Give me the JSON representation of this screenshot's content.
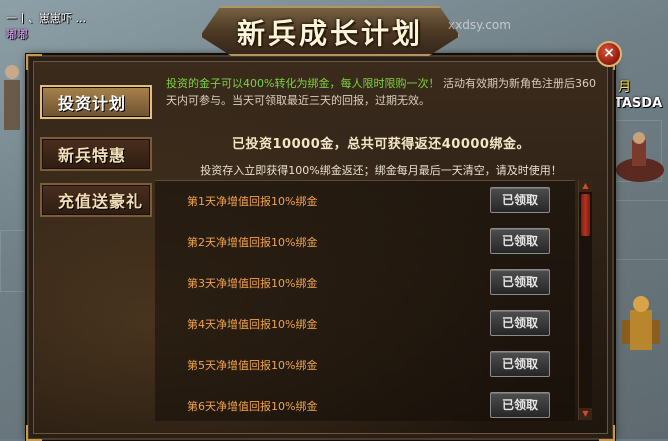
{
  "scene": {
    "top_left_line": "一丨、崽崽吓 ...",
    "top_left_name": "嘟嘟",
    "top_right_char": "月",
    "right_name": "TASDA"
  },
  "window": {
    "title": "新兵成长计划",
    "watermark": "xxdsy.com",
    "close_label": "×"
  },
  "tabs": [
    {
      "label": "投资计划",
      "active": true
    },
    {
      "label": "新兵特惠",
      "active": false
    },
    {
      "label": "充值送豪礼",
      "active": false
    }
  ],
  "content": {
    "desc_highlight": "投资的金子可以400%转化为绑金，每人限时限购一次！",
    "desc_rest": "活动有效期为新角色注册后360天内可参与。当天可领取最近三天的回报，过期无效。",
    "summary": "已投资10000金，总共可获得返还40000绑金。",
    "note": "投资存入立即获得100%绑金返还；绑金每月最后一天清空，请及时使用！"
  },
  "rows": [
    {
      "label": "第1天净增值回报10%绑金",
      "button": "已领取"
    },
    {
      "label": "第2天净增值回报10%绑金",
      "button": "已领取"
    },
    {
      "label": "第3天净增值回报10%绑金",
      "button": "已领取"
    },
    {
      "label": "第4天净增值回报10%绑金",
      "button": "已领取"
    },
    {
      "label": "第5天净增值回报10%绑金",
      "button": "已领取"
    },
    {
      "label": "第6天净增值回报10%绑金",
      "button": "已领取"
    }
  ],
  "icons": {
    "close": "close-icon",
    "scroll_up": "arrow-up-icon",
    "scroll_down": "arrow-down-icon"
  },
  "colors": {
    "highlight_green": "#7cd23e",
    "row_text_orange": "#f0a34a",
    "accent_gold": "#c79a4a"
  }
}
